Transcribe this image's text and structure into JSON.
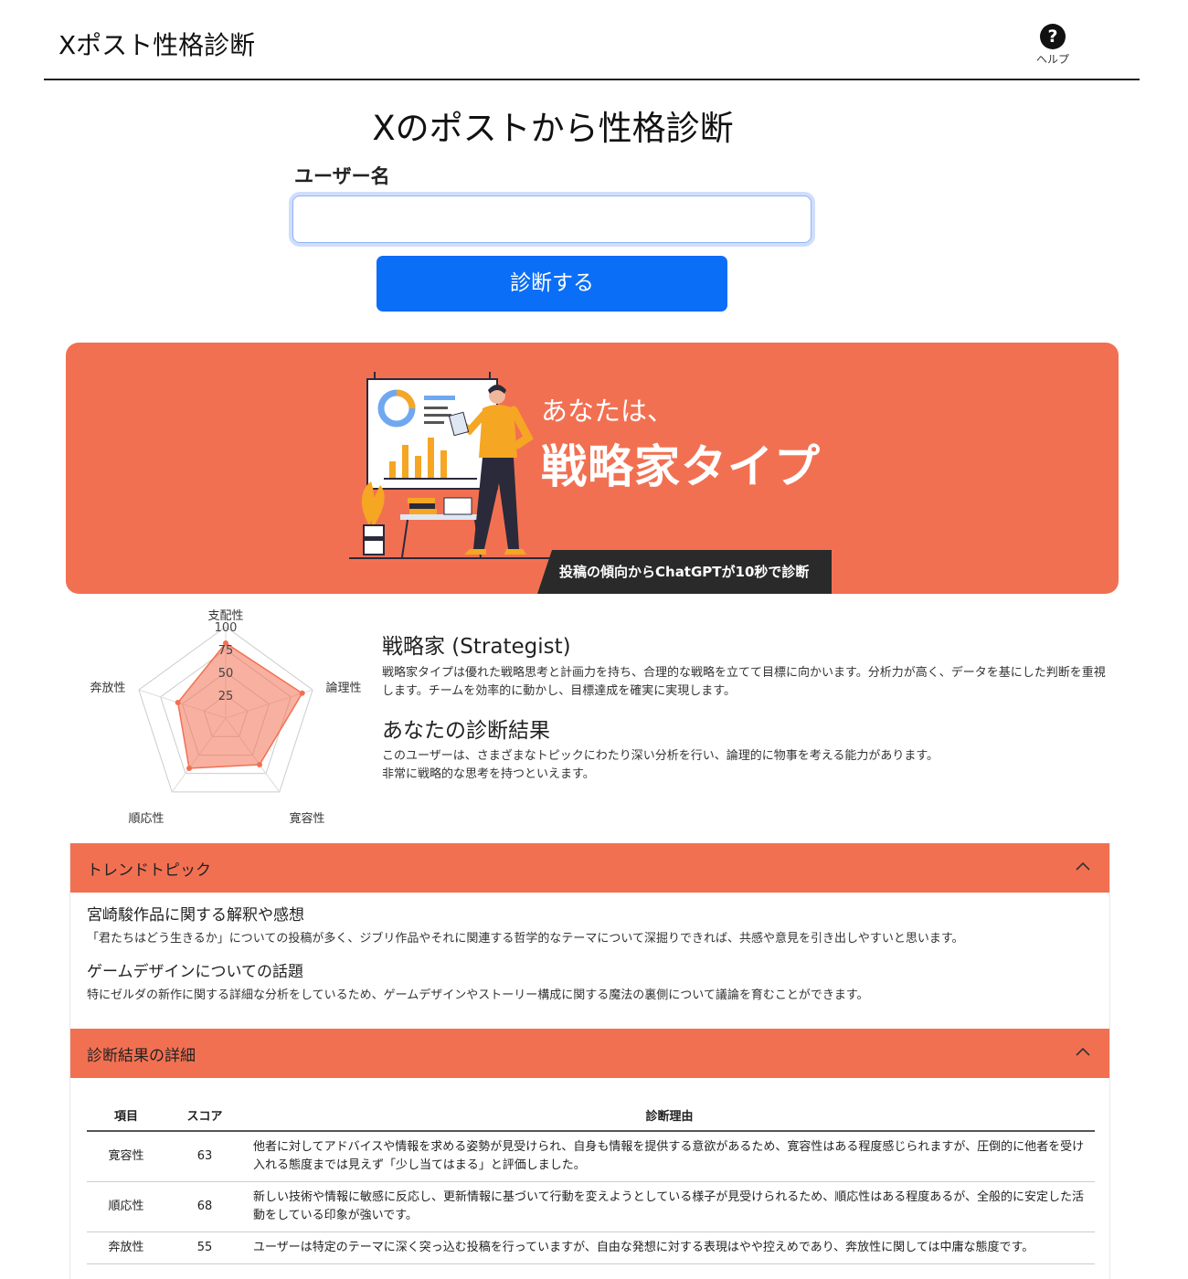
{
  "header": {
    "app_title": "Xポスト性格診断",
    "help_label": "ヘルプ",
    "help_icon": "question-circle-icon"
  },
  "form": {
    "title": "Xのポストから性格診断",
    "username_label": "ユーザー名",
    "username_value": "",
    "submit_label": "診断する"
  },
  "banner": {
    "subtitle": "あなたは、",
    "type_name": "戦略家タイプ",
    "tagline": "投稿の傾向からChatGPTが10秒で診断",
    "background_color": "#f27052"
  },
  "radar": {
    "axes": [
      "支配性",
      "論理性",
      "寛容性",
      "順応性",
      "奔放性"
    ],
    "ticks": [
      "25",
      "50",
      "75",
      "100"
    ],
    "max": 100,
    "values": [
      82,
      88,
      63,
      68,
      55
    ],
    "fill_color": "#f27052"
  },
  "result": {
    "type_title": "戦略家 (Strategist)",
    "type_description": "戦略家タイプは優れた戦略思考と計画力を持ち、合理的な戦略を立てて目標に向かいます。分析力が高く、データを基にした判断を重視します。チームを効率的に動かし、目標達成を確実に実現します。",
    "result_title": "あなたの診断結果",
    "result_line1": "このユーザーは、さまざまなトピックにわたり深い分析を行い、論理的に物事を考える能力があります。",
    "result_line2": "非常に戦略的な思考を持つといえます。"
  },
  "trend": {
    "heading": "トレンドトピック",
    "topics": [
      {
        "title": "宮崎駿作品に関する解釈や感想",
        "description": "「君たちはどう生きるか」についての投稿が多く、ジブリ作品やそれに関連する哲学的なテーマについて深掘りできれば、共感や意見を引き出しやすいと思います。"
      },
      {
        "title": "ゲームデザインについての話題",
        "description": "特にゼルダの新作に関する詳細な分析をしているため、ゲームデザインやストーリー構成に関する魔法の裏側について議論を育むことができます。"
      }
    ]
  },
  "details": {
    "heading": "診断結果の詳細",
    "columns": [
      "項目",
      "スコア",
      "診断理由"
    ],
    "rows": [
      {
        "item": "寛容性",
        "score": "63",
        "reason": "他者に対してアドバイスや情報を求める姿勢が見受けられ、自身も情報を提供する意欲があるため、寛容性はある程度感じられますが、圧倒的に他者を受け入れる態度までは見えず「少し当てはまる」と評価しました。"
      },
      {
        "item": "順応性",
        "score": "68",
        "reason": "新しい技術や情報に敏感に反応し、更新情報に基づいて行動を変えようとしている様子が見受けられるため、順応性はある程度あるが、全般的に安定した活動をしている印象が強いです。"
      },
      {
        "item": "奔放性",
        "score": "55",
        "reason": "ユーザーは特定のテーマに深く突っ込む投稿を行っていますが、自由な発想に対する表現はやや控えめであり、奔放性に関しては中庸な態度です。"
      }
    ]
  }
}
